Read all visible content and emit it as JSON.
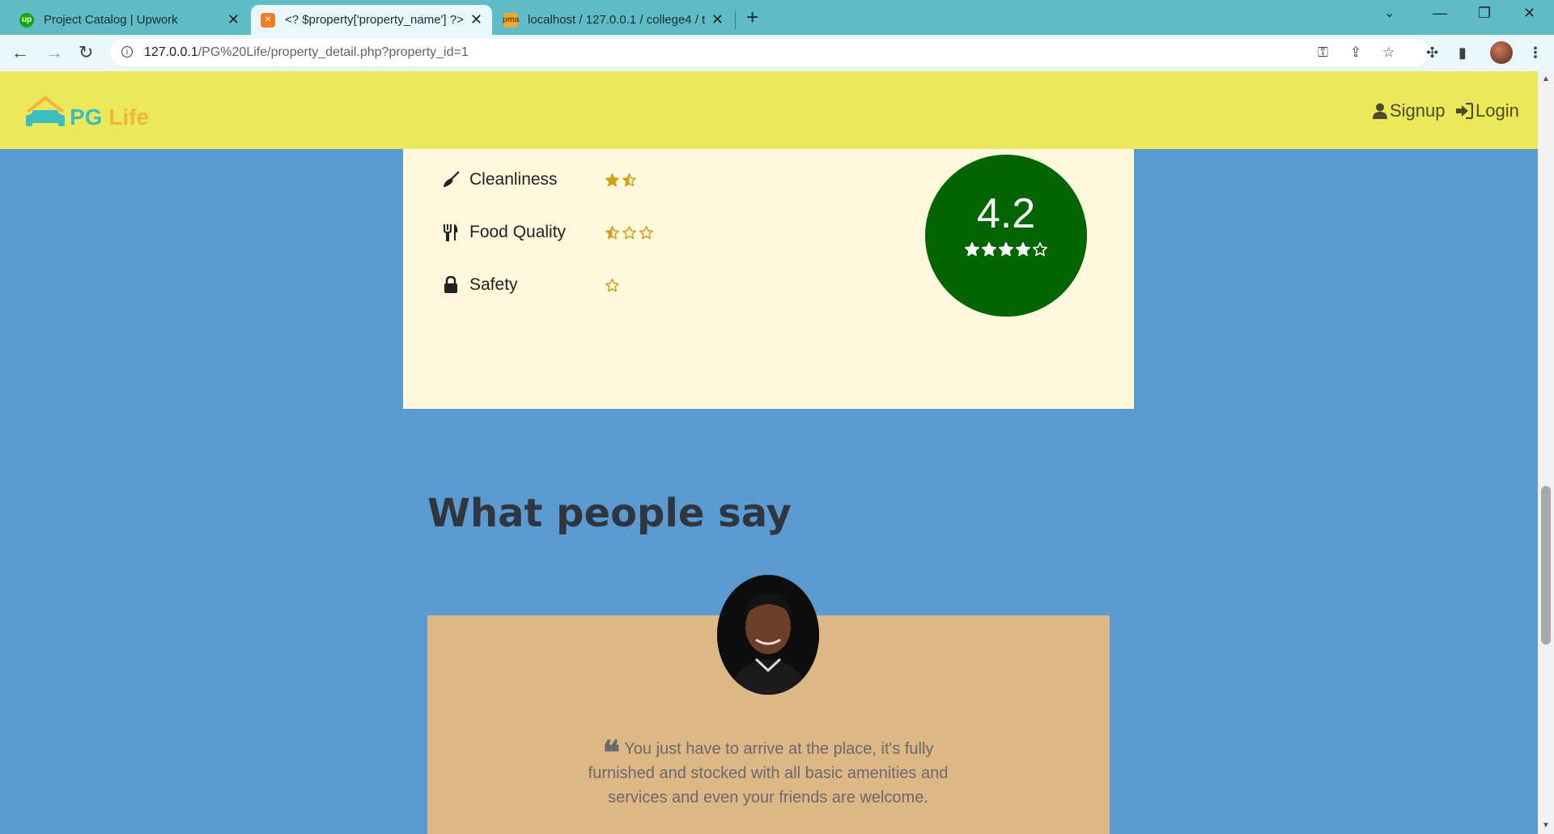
{
  "browser": {
    "tabs": [
      {
        "title": "Project Catalog | Upwork",
        "favicon": "upwork-icon"
      },
      {
        "title": "<? $property['property_name'] ?>",
        "favicon": "xampp-icon"
      },
      {
        "title": "localhost / 127.0.0.1 / college4 / t",
        "favicon": "phpmyadmin-icon"
      }
    ],
    "url_host": "127.0.0.1",
    "url_path": "/PG%20Life/property_detail.php?property_id=1"
  },
  "header": {
    "logo_pg": "PG",
    "logo_life": "Life",
    "signup_label": "Signup",
    "login_label": "Login"
  },
  "ratings": {
    "items": [
      {
        "label": "Cleanliness",
        "icon": "broom-icon",
        "stars": 1.5,
        "star_count": 2
      },
      {
        "label": "Food Quality",
        "icon": "utensils-icon",
        "stars": 0.5,
        "star_count": 3
      },
      {
        "label": "Safety",
        "icon": "lock-icon",
        "stars": 0,
        "star_count": 1
      }
    ],
    "overall": "4.2",
    "overall_stars_filled": 4,
    "overall_stars_total": 5
  },
  "testimonials": {
    "section_title": "What people say",
    "quote": "You just have to arrive at the place, it's fully furnished and stocked with all basic amenities and services and even your friends are welcome."
  },
  "colors": {
    "page_bg": "#5b9bd2",
    "header_bg": "#ebe95a",
    "rating_card_bg": "#fff8dc",
    "score_circle": "#006400",
    "testimonial_bg": "#ddb785",
    "star_gold": "#d4a017"
  }
}
